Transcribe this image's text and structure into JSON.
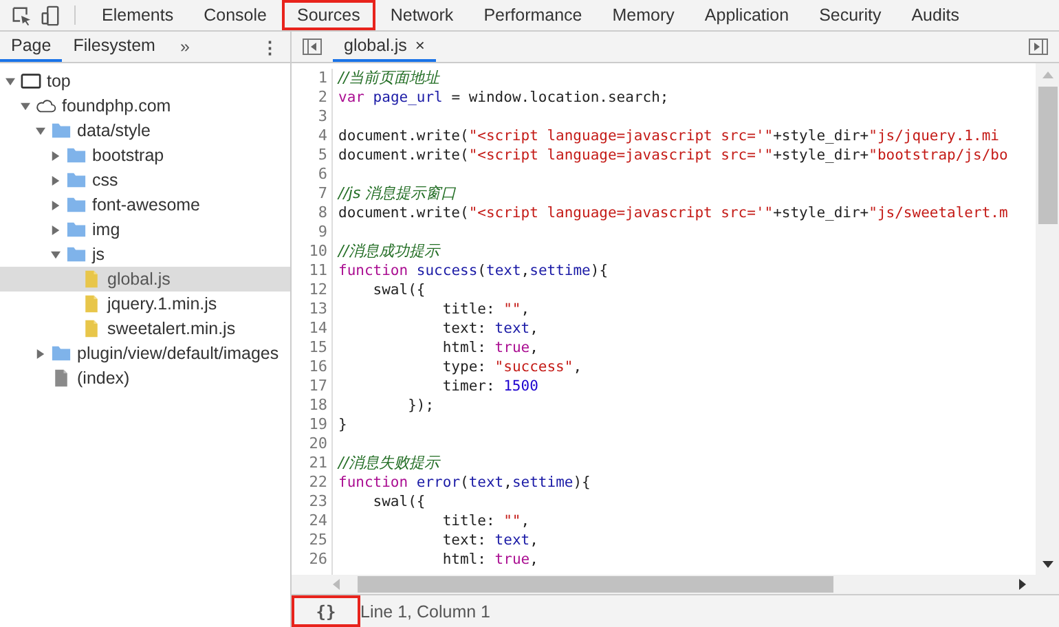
{
  "toolbar": {
    "tabs": [
      {
        "label": "Elements",
        "highlighted": false
      },
      {
        "label": "Console",
        "highlighted": false
      },
      {
        "label": "Sources",
        "highlighted": true
      },
      {
        "label": "Network",
        "highlighted": false
      },
      {
        "label": "Performance",
        "highlighted": false
      },
      {
        "label": "Memory",
        "highlighted": false
      },
      {
        "label": "Application",
        "highlighted": false
      },
      {
        "label": "Security",
        "highlighted": false
      },
      {
        "label": "Audits",
        "highlighted": false
      }
    ]
  },
  "navigator": {
    "tabs": [
      {
        "label": "Page",
        "selected": true
      },
      {
        "label": "Filesystem",
        "selected": false
      }
    ],
    "more": "»",
    "menu": "⋮",
    "tree": [
      {
        "label": "top",
        "kind": "frame",
        "expanded": true,
        "selected": false,
        "children": [
          {
            "label": "foundphp.com",
            "kind": "domain",
            "expanded": true,
            "selected": false,
            "children": [
              {
                "label": "data/style",
                "kind": "folder",
                "expanded": true,
                "selected": false,
                "children": [
                  {
                    "label": "bootstrap",
                    "kind": "folder",
                    "expanded": false,
                    "selected": false
                  },
                  {
                    "label": "css",
                    "kind": "folder",
                    "expanded": false,
                    "selected": false
                  },
                  {
                    "label": "font-awesome",
                    "kind": "folder",
                    "expanded": false,
                    "selected": false
                  },
                  {
                    "label": "img",
                    "kind": "folder",
                    "expanded": false,
                    "selected": false
                  },
                  {
                    "label": "js",
                    "kind": "folder",
                    "expanded": true,
                    "selected": false,
                    "children": [
                      {
                        "label": "global.js",
                        "kind": "script",
                        "selected": true
                      },
                      {
                        "label": "jquery.1.min.js",
                        "kind": "script",
                        "selected": false
                      },
                      {
                        "label": "sweetalert.min.js",
                        "kind": "script",
                        "selected": false
                      }
                    ]
                  }
                ]
              },
              {
                "label": "plugin/view/default/images",
                "kind": "folder",
                "expanded": false,
                "selected": false
              },
              {
                "label": "(index)",
                "kind": "document",
                "selected": false
              }
            ]
          }
        ]
      }
    ]
  },
  "editor": {
    "tabs": [
      {
        "label": "global.js",
        "selected": true,
        "close": "×"
      }
    ],
    "lines": [
      {
        "number": "1",
        "tokens": [
          {
            "kind": "comment",
            "text": "//当前页面地址"
          }
        ]
      },
      {
        "number": "2",
        "tokens": [
          {
            "kind": "keyword",
            "text": "var "
          },
          {
            "kind": "variable",
            "text": "page_url"
          },
          {
            "kind": "plain",
            "text": " = window.location.search;"
          }
        ]
      },
      {
        "number": "3"
      },
      {
        "number": "4",
        "tokens": [
          {
            "kind": "plain",
            "text": "document.write("
          },
          {
            "kind": "string",
            "text": "\"<script language=javascript src='\""
          },
          {
            "kind": "plain",
            "text": "+style_dir+"
          },
          {
            "kind": "string",
            "text": "\"js/jquery.1.mi"
          }
        ]
      },
      {
        "number": "5",
        "tokens": [
          {
            "kind": "plain",
            "text": "document.write("
          },
          {
            "kind": "string",
            "text": "\"<script language=javascript src='\""
          },
          {
            "kind": "plain",
            "text": "+style_dir+"
          },
          {
            "kind": "string",
            "text": "\"bootstrap/js/bo"
          }
        ]
      },
      {
        "number": "6"
      },
      {
        "number": "7",
        "tokens": [
          {
            "kind": "comment",
            "text": "//js 消息提示窗口"
          }
        ]
      },
      {
        "number": "8",
        "tokens": [
          {
            "kind": "plain",
            "text": "document.write("
          },
          {
            "kind": "string",
            "text": "\"<script language=javascript src='\""
          },
          {
            "kind": "plain",
            "text": "+style_dir+"
          },
          {
            "kind": "string",
            "text": "\"js/sweetalert.m"
          }
        ]
      },
      {
        "number": "9"
      },
      {
        "number": "10",
        "tokens": [
          {
            "kind": "comment",
            "text": "//消息成功提示"
          }
        ]
      },
      {
        "number": "11",
        "tokens": [
          {
            "kind": "keyword",
            "text": "function "
          },
          {
            "kind": "variable",
            "text": "success"
          },
          {
            "kind": "plain",
            "text": "("
          },
          {
            "kind": "variable",
            "text": "text"
          },
          {
            "kind": "plain",
            "text": ","
          },
          {
            "kind": "variable",
            "text": "settime"
          },
          {
            "kind": "plain",
            "text": "){"
          }
        ]
      },
      {
        "number": "12",
        "tokens": [
          {
            "kind": "plain",
            "text": "    swal({"
          }
        ]
      },
      {
        "number": "13",
        "tokens": [
          {
            "kind": "plain",
            "text": "            title: "
          },
          {
            "kind": "string",
            "text": "\"\""
          },
          {
            "kind": "plain",
            "text": ","
          }
        ]
      },
      {
        "number": "14",
        "tokens": [
          {
            "kind": "plain",
            "text": "            text: "
          },
          {
            "kind": "variable",
            "text": "text"
          },
          {
            "kind": "plain",
            "text": ","
          }
        ]
      },
      {
        "number": "15",
        "tokens": [
          {
            "kind": "plain",
            "text": "            html: "
          },
          {
            "kind": "keyword",
            "text": "true"
          },
          {
            "kind": "plain",
            "text": ","
          }
        ]
      },
      {
        "number": "16",
        "tokens": [
          {
            "kind": "plain",
            "text": "            type: "
          },
          {
            "kind": "string",
            "text": "\"success\""
          },
          {
            "kind": "plain",
            "text": ","
          }
        ]
      },
      {
        "number": "17",
        "tokens": [
          {
            "kind": "plain",
            "text": "            timer: "
          },
          {
            "kind": "number",
            "text": "1500"
          }
        ]
      },
      {
        "number": "18",
        "tokens": [
          {
            "kind": "plain",
            "text": "        });"
          }
        ]
      },
      {
        "number": "19",
        "tokens": [
          {
            "kind": "plain",
            "text": "}"
          }
        ]
      },
      {
        "number": "20"
      },
      {
        "number": "21",
        "tokens": [
          {
            "kind": "comment",
            "text": "//消息失败提示"
          }
        ]
      },
      {
        "number": "22",
        "tokens": [
          {
            "kind": "keyword",
            "text": "function "
          },
          {
            "kind": "variable",
            "text": "error"
          },
          {
            "kind": "plain",
            "text": "("
          },
          {
            "kind": "variable",
            "text": "text"
          },
          {
            "kind": "plain",
            "text": ","
          },
          {
            "kind": "variable",
            "text": "settime"
          },
          {
            "kind": "plain",
            "text": "){"
          }
        ]
      },
      {
        "number": "23",
        "tokens": [
          {
            "kind": "plain",
            "text": "    swal({"
          }
        ]
      },
      {
        "number": "24",
        "tokens": [
          {
            "kind": "plain",
            "text": "            title: "
          },
          {
            "kind": "string",
            "text": "\"\""
          },
          {
            "kind": "plain",
            "text": ","
          }
        ]
      },
      {
        "number": "25",
        "tokens": [
          {
            "kind": "plain",
            "text": "            text: "
          },
          {
            "kind": "variable",
            "text": "text"
          },
          {
            "kind": "plain",
            "text": ","
          }
        ]
      },
      {
        "number": "26",
        "tokens": [
          {
            "kind": "plain",
            "text": "            html: "
          },
          {
            "kind": "keyword",
            "text": "true"
          },
          {
            "kind": "plain",
            "text": ","
          }
        ]
      }
    ]
  },
  "status_bar": {
    "format_button": {
      "label": "{}",
      "highlighted": true
    },
    "position": "Line 1, Column 1"
  }
}
